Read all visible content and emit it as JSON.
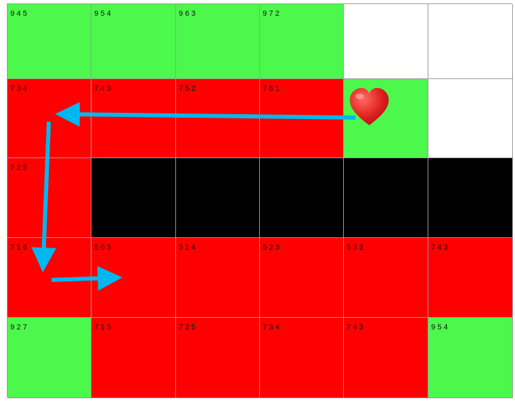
{
  "colors": {
    "green": "#4cf84c",
    "red": "#ff0000",
    "black": "#000000",
    "white": "#ffffff",
    "arrow": "#00b7f0",
    "heart": "#e0201e"
  },
  "icons": {
    "heart": "heart-icon",
    "arrow": "path-arrow-icon"
  },
  "grid": {
    "rows": [
      [
        {
          "color": "green",
          "value": "945"
        },
        {
          "color": "green",
          "value": "954"
        },
        {
          "color": "green",
          "value": "963"
        },
        {
          "color": "green",
          "value": "972"
        },
        {
          "color": "white",
          "value": ""
        },
        {
          "color": "white",
          "value": ""
        }
      ],
      [
        {
          "color": "red",
          "value": "734"
        },
        {
          "color": "red",
          "value": "743"
        },
        {
          "color": "red",
          "value": "752"
        },
        {
          "color": "red",
          "value": "761"
        },
        {
          "color": "green",
          "value": ""
        },
        {
          "color": "white",
          "value": ""
        }
      ],
      [
        {
          "color": "red",
          "value": "725"
        },
        {
          "color": "black",
          "value": ""
        },
        {
          "color": "black",
          "value": ""
        },
        {
          "color": "black",
          "value": ""
        },
        {
          "color": "black",
          "value": ""
        },
        {
          "color": "black",
          "value": ""
        }
      ],
      [
        {
          "color": "red",
          "value": "716"
        },
        {
          "color": "red",
          "value": "505"
        },
        {
          "color": "red",
          "value": "514"
        },
        {
          "color": "red",
          "value": "523"
        },
        {
          "color": "red",
          "value": "532"
        },
        {
          "color": "red",
          "value": "743"
        }
      ],
      [
        {
          "color": "green",
          "value": "927"
        },
        {
          "color": "red",
          "value": "716"
        },
        {
          "color": "red",
          "value": "725"
        },
        {
          "color": "red",
          "value": "734"
        },
        {
          "color": "red",
          "value": "743"
        },
        {
          "color": "green",
          "value": "954"
        }
      ]
    ]
  }
}
